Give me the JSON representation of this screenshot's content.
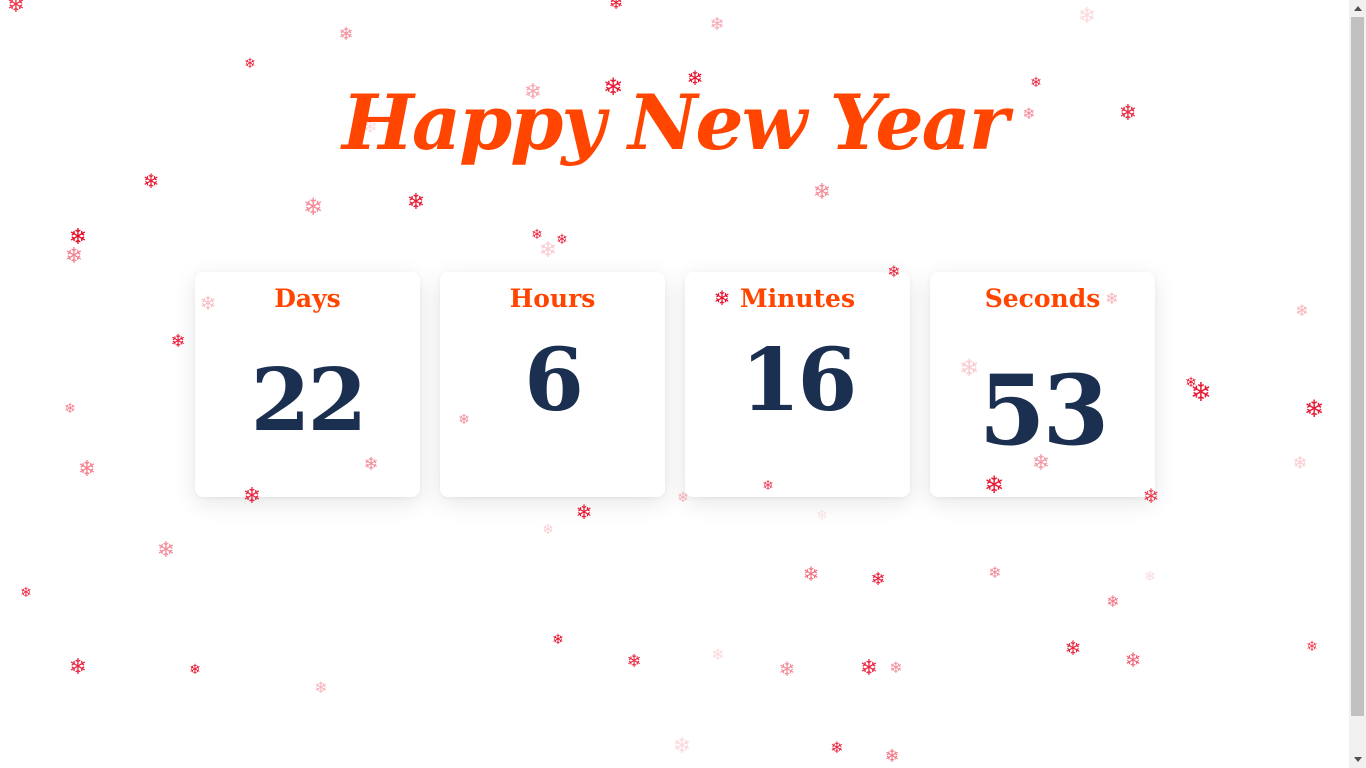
{
  "title": "Happy New Year",
  "colors": {
    "title": "#ff4500",
    "label": "#ff4500",
    "value": "#1b2f50",
    "snowflake": "#e6001f"
  },
  "countdown": {
    "days": {
      "label": "Days",
      "value": "22"
    },
    "hours": {
      "label": "Hours",
      "value": "6"
    },
    "minutes": {
      "label": "Minutes",
      "value": "16"
    },
    "seconds": {
      "label": "Seconds",
      "value": "53"
    }
  },
  "snowflake_glyph": "❄"
}
